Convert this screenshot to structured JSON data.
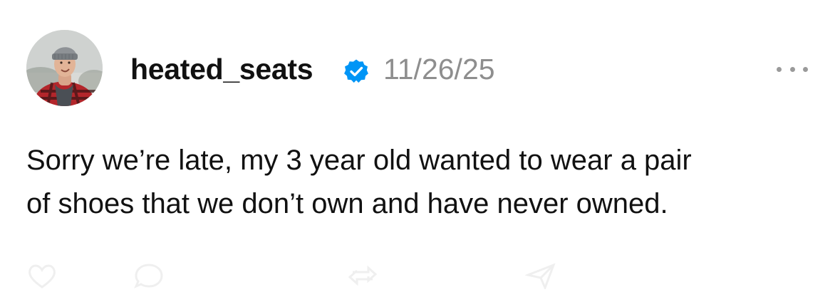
{
  "post": {
    "username": "heated_seats",
    "timestamp": "11/26/25",
    "text_lines": [
      "Sorry we’re late, my 3 year old wanted to wear a pair",
      "of shoes that we don’t own and have never owned."
    ],
    "icons": {
      "avatar": "profile-photo",
      "verified": "verified-badge-icon",
      "more": "more-options-icon"
    },
    "colors": {
      "verified": "#0095f6",
      "timestamp": "#8e8e8e",
      "text": "#111111"
    }
  }
}
